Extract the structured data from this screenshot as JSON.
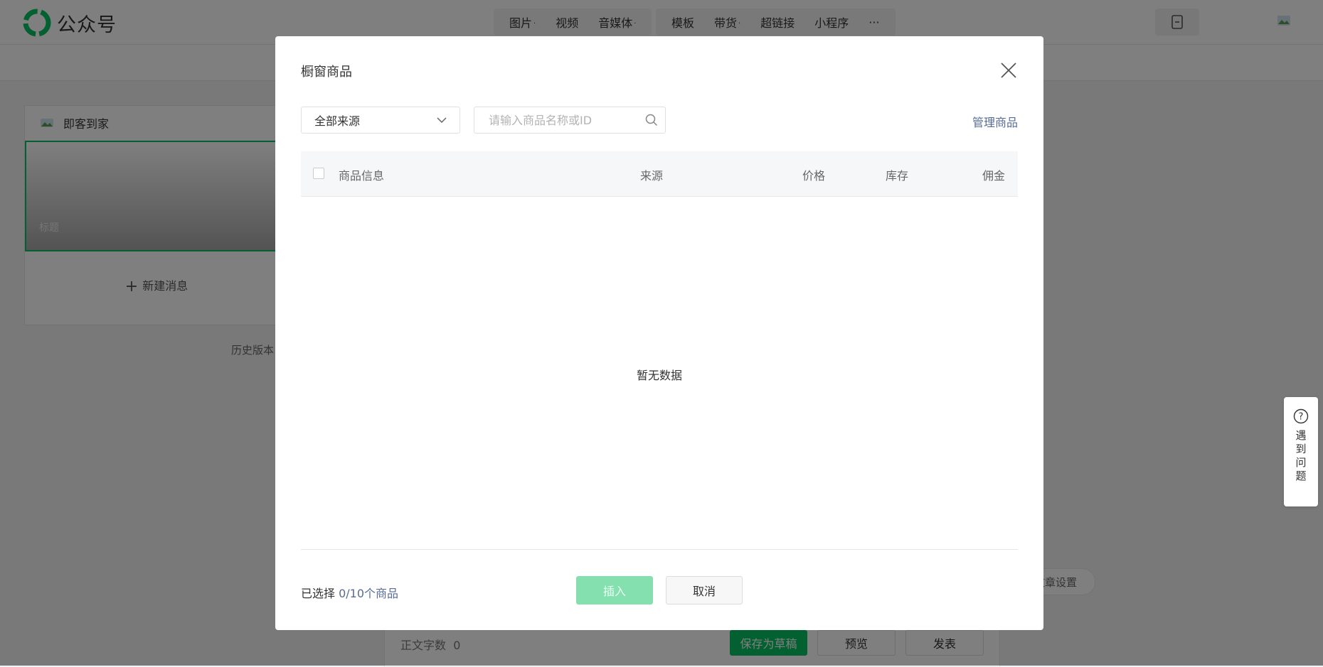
{
  "app": {
    "name": "公众号"
  },
  "toolbar": {
    "group1": [
      "图片",
      "视频",
      "音媒体"
    ],
    "group2": [
      "模板",
      "带货",
      "超链接",
      "小程序"
    ],
    "more": "···"
  },
  "left_panel": {
    "account_name": "即客到家",
    "cover_label": "标题",
    "new_message": "新建消息",
    "history": "历史版本"
  },
  "editor_footer": {
    "word_count_label": "正文字数",
    "word_count": "0",
    "save_draft": "保存为草稿",
    "preview": "预览",
    "publish": "发表",
    "article_settings": "文章设置"
  },
  "help": {
    "label": "遇到问题"
  },
  "dialog": {
    "title": "橱窗商品",
    "source_select": "全部来源",
    "search_placeholder": "请输入商品名称或ID",
    "manage": "管理商品",
    "columns": [
      "商品信息",
      "来源",
      "价格",
      "库存",
      "佣金"
    ],
    "empty": "暂无数据",
    "selected_prefix": "已选择",
    "selected_count": "0/10个商品",
    "insert": "插入",
    "cancel": "取消"
  },
  "colors": {
    "brand_green": "#07c160",
    "link_blue": "#576b95"
  }
}
